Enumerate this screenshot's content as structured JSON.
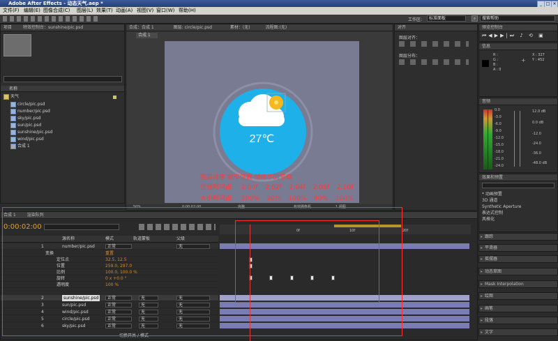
{
  "window": {
    "title": "Adobe After Effects - 动态天气.aep *",
    "controls": [
      "_",
      "□",
      "×"
    ]
  },
  "menu": [
    "文件(F)",
    "编辑(E)",
    "图像合成(C)",
    "图层(L)",
    "效果(T)",
    "动画(A)",
    "视图(V)",
    "窗口(W)",
    "帮助(H)"
  ],
  "workspace": {
    "label": "工作区:",
    "value": "标准面板",
    "search": "搜索帮助"
  },
  "project": {
    "tab1": "项目",
    "tab2": "特效控制台：sunshine/pic.psd",
    "col_name": "名称",
    "items": [
      "天气",
      "circle/pic.psd",
      "number/pic.psd",
      "sky/pic.psd",
      "sun/pic.psd",
      "sunshine/pic.psd",
      "wind/pic.psd",
      "合成 1"
    ]
  },
  "comp": {
    "tab": "合成：合成 1",
    "subtab": "合成 1",
    "layer_tab": "图层: circle/pic.psd",
    "footage_tab": "素材：(无)",
    "flow_tab": "流程图:(无)",
    "temperature": "27℃",
    "zoom": "50%",
    "status": "0:00:02:00",
    "res": "完整",
    "camera": "有效摄像机",
    "views": "1 视图"
  },
  "annotation": {
    "line1": "图层排序  帧率倍数  帧率不同节奏",
    "line2_label": "位置时间点:",
    "times": [
      "2:00f",
      "2:02f",
      "2:04f",
      "2:08f",
      "2:10f"
    ],
    "line3_label": "大小时间点:",
    "percents": [
      "100%",
      "90%",
      "100%",
      "90%",
      "100%"
    ]
  },
  "align": {
    "tab": "对齐",
    "align_to": "图层对齐：",
    "distribute": "图层分布："
  },
  "preview": {
    "tab": "预览控制台"
  },
  "info": {
    "tab": "信息",
    "R": "R :",
    "G": "G :",
    "B": "B :",
    "A": "A : 0",
    "X": "X : 327",
    "Y": "Y : 452"
  },
  "audio": {
    "tab": "音频",
    "left_levels": [
      "0.0",
      "-3.0",
      "-6.0",
      "-9.0",
      "-12.0",
      "-15.0",
      "-18.0",
      "-21.0",
      "-24.0"
    ],
    "right_levels": [
      "12.0 dB",
      "0.0 dB",
      "-12.0",
      "-24.0",
      "-36.0",
      "-48.0 dB"
    ]
  },
  "effects": {
    "tab": "效果和预置",
    "items": [
      "* 动画预置",
      "3D 通道",
      "Synthetic Aperture",
      "表达式控制",
      "风格化"
    ]
  },
  "right_panels": [
    "跟踪",
    "平滑器",
    "摇摆器",
    "动态草图",
    "Mask Interpolation",
    "绘图",
    "画笔",
    "段落",
    "文字"
  ],
  "timeline": {
    "tab1": "合成 1",
    "tab2": "渲染队列",
    "timecode": "0:00:02:00",
    "col_source": "源名称",
    "col_mode": "模式",
    "col_trk": "轨道蒙板",
    "col_parent": "父级",
    "ruler": [
      "0f",
      "10f",
      "20f"
    ],
    "layers": [
      {
        "num": "1",
        "name": "number/pic.psd",
        "mode": "正常",
        "parent": "无"
      },
      {
        "num": "2",
        "name": "sunshine/pic.psd",
        "mode": "正常",
        "trk": "无",
        "parent": "无"
      },
      {
        "num": "3",
        "name": "sun/pic.psd",
        "mode": "正常",
        "trk": "无",
        "parent": "无"
      },
      {
        "num": "4",
        "name": "wind/pic.psd",
        "mode": "正常",
        "trk": "无",
        "parent": "无"
      },
      {
        "num": "5",
        "name": "circle/pic.psd",
        "mode": "正常",
        "trk": "无",
        "parent": "无"
      },
      {
        "num": "6",
        "name": "sky/pic.psd",
        "mode": "正常",
        "trk": "无",
        "parent": "无"
      }
    ],
    "transform": {
      "label": "变换",
      "reset": "重置",
      "props": [
        {
          "name": "定位点",
          "value": "32.5, 12.5"
        },
        {
          "name": "位置",
          "value": "259.0, 297.0"
        },
        {
          "name": "比例",
          "value": "100.0, 100.0 %"
        },
        {
          "name": "旋转",
          "value": "0 x +0.0 °"
        },
        {
          "name": "透明度",
          "value": "100 %"
        }
      ]
    },
    "footer": "切换开关 / 模式"
  }
}
